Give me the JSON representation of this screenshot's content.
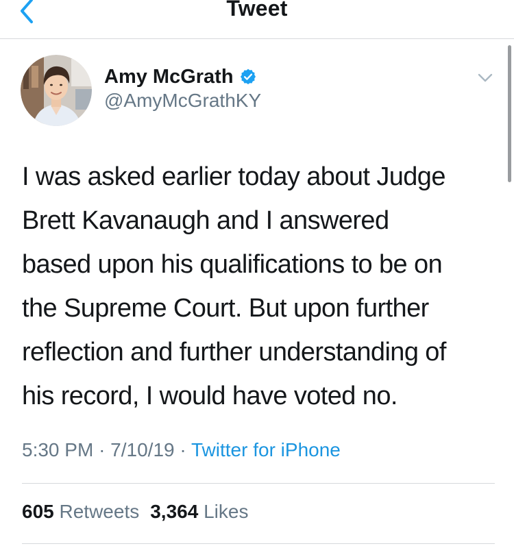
{
  "nav": {
    "title": "Tweet",
    "back_icon": "chevron-left-icon"
  },
  "tweet": {
    "author": {
      "display_name": "Amy McGrath",
      "handle": "@AmyMcGrathKY",
      "verified": true,
      "avatar_icon": "profile-photo"
    },
    "text_lines": [
      "I was asked earlier today about Judge",
      "Brett Kavanaugh and I answered",
      "based upon his qualifications to be on",
      "the Supreme Court. But upon further",
      "reflection and further understanding of",
      "his record, I would have voted no."
    ],
    "time": "5:30 PM",
    "date": "7/10/19",
    "separator": "·",
    "source": "Twitter for iPhone",
    "retweets_count": "605",
    "retweets_label": "Retweets",
    "likes_count": "3,364",
    "likes_label": "Likes"
  },
  "colors": {
    "accent": "#1da1f2",
    "link": "#1b95e0",
    "secondary_text": "#657786",
    "primary_text": "#14171a",
    "divider": "#d6d9dc"
  }
}
